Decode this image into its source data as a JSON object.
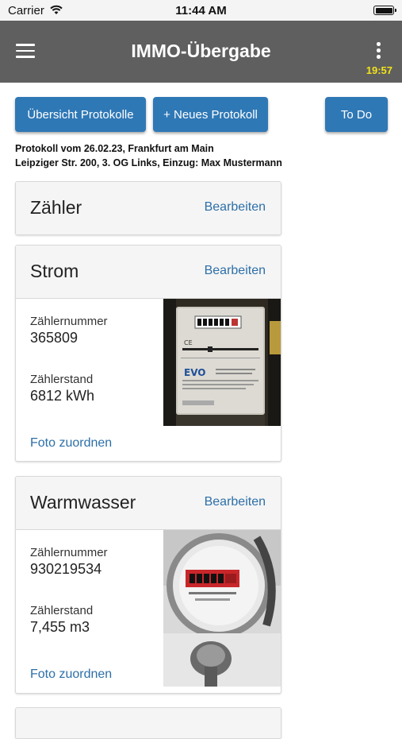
{
  "status_bar": {
    "carrier": "Carrier",
    "time": "11:44 AM"
  },
  "app_bar": {
    "title": "IMMO-Übergabe",
    "timer": "19:57"
  },
  "toolbar": {
    "overview_label": "Übersicht Protokolle",
    "new_label": "+ Neues Protokoll",
    "todo_label": "To Do"
  },
  "protocol": {
    "line1": "Protokoll vom 26.02.23, Frankfurt am Main",
    "line2": "Leipziger Str. 200, 3. OG Links, Einzug: Max Mustermann"
  },
  "section": {
    "title": "Zähler",
    "edit_label": "Bearbeiten"
  },
  "meters": [
    {
      "title": "Strom",
      "edit_label": "Bearbeiten",
      "number_label": "Zählernummer",
      "number": "365809",
      "reading_label": "Zählerstand",
      "reading": "6812 kWh",
      "photo_link": "Foto zuordnen",
      "photo_brand": "EVO"
    },
    {
      "title": "Warmwasser",
      "edit_label": "Bearbeiten",
      "number_label": "Zählernummer",
      "number": "930219534",
      "reading_label": "Zählerstand",
      "reading": "7,455 m3",
      "photo_link": "Foto zuordnen"
    }
  ],
  "colors": {
    "appbar": "#5f5f5f",
    "button": "#2f78b6",
    "link": "#2d6fa8",
    "timer": "#f2e21a"
  }
}
